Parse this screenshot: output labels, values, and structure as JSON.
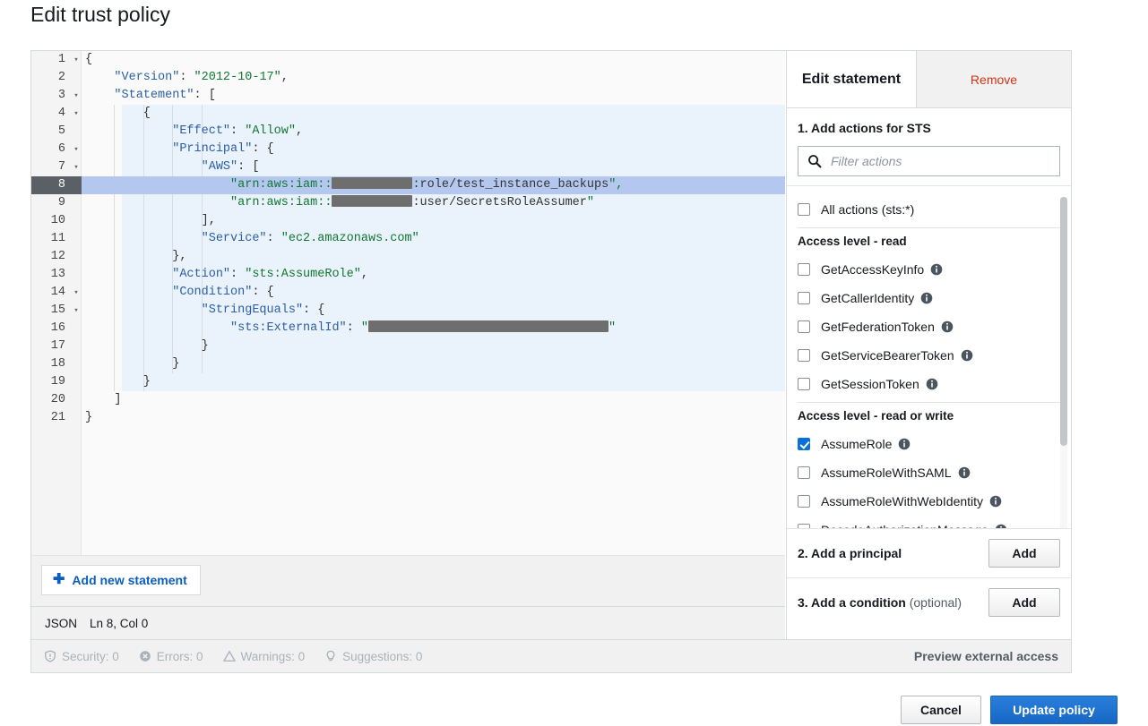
{
  "page_title": "Edit trust policy",
  "editor": {
    "language_label": "JSON",
    "cursor_label": "Ln 8, Col 0",
    "add_statement_label": "Add new statement",
    "add_statement_icon": "plus-icon",
    "active_line": 8,
    "lines": [
      {
        "n": "1",
        "fold": true,
        "text": "{"
      },
      {
        "n": "2",
        "fold": false,
        "text": "    \"Version\": \"2012-10-17\","
      },
      {
        "n": "3",
        "fold": true,
        "text": "    \"Statement\": ["
      },
      {
        "n": "4",
        "fold": true,
        "text": "        {"
      },
      {
        "n": "5",
        "fold": false,
        "text": "            \"Effect\": \"Allow\","
      },
      {
        "n": "6",
        "fold": true,
        "text": "            \"Principal\": {"
      },
      {
        "n": "7",
        "fold": true,
        "text": "                \"AWS\": ["
      },
      {
        "n": "8",
        "fold": false,
        "text": "                    \"arn:aws:iam::[REDACTED]:role/test_instance_backups\","
      },
      {
        "n": "9",
        "fold": false,
        "text": "                    \"arn:aws:iam::[REDACTED]:user/SecretsRoleAssumer\""
      },
      {
        "n": "10",
        "fold": false,
        "text": "                ],"
      },
      {
        "n": "11",
        "fold": false,
        "text": "                \"Service\": \"ec2.amazonaws.com\""
      },
      {
        "n": "12",
        "fold": false,
        "text": "            },"
      },
      {
        "n": "13",
        "fold": false,
        "text": "            \"Action\": \"sts:AssumeRole\","
      },
      {
        "n": "14",
        "fold": true,
        "text": "            \"Condition\": {"
      },
      {
        "n": "15",
        "fold": true,
        "text": "                \"StringEquals\": {"
      },
      {
        "n": "16",
        "fold": false,
        "text": "                    \"sts:ExternalId\": \"[REDACTED]\""
      },
      {
        "n": "17",
        "fold": false,
        "text": "                }"
      },
      {
        "n": "18",
        "fold": false,
        "text": "            }"
      },
      {
        "n": "19",
        "fold": false,
        "text": "        }"
      },
      {
        "n": "20",
        "fold": false,
        "text": "    ]"
      },
      {
        "n": "21",
        "fold": false,
        "text": "}"
      }
    ]
  },
  "side_panel": {
    "tab_label": "Edit statement",
    "remove_label": "Remove",
    "step1_title": "1. Add actions for STS",
    "filter_placeholder": "Filter actions",
    "filter_value": "",
    "search_icon": "search-icon",
    "all_actions_label": "All actions (sts:*)",
    "all_actions_checked": false,
    "groups": [
      {
        "header": "Access level - read",
        "items": [
          {
            "label": "GetAccessKeyInfo",
            "checked": false,
            "info": true
          },
          {
            "label": "GetCallerIdentity",
            "checked": false,
            "info": true
          },
          {
            "label": "GetFederationToken",
            "checked": false,
            "info": true
          },
          {
            "label": "GetServiceBearerToken",
            "checked": false,
            "info": true
          },
          {
            "label": "GetSessionToken",
            "checked": false,
            "info": true
          }
        ]
      },
      {
        "header": "Access level - read or write",
        "items": [
          {
            "label": "AssumeRole",
            "checked": true,
            "info": true
          },
          {
            "label": "AssumeRoleWithSAML",
            "checked": false,
            "info": true
          },
          {
            "label": "AssumeRoleWithWebIdentity",
            "checked": false,
            "info": true
          },
          {
            "label": "DecodeAuthorizationMessage",
            "checked": false,
            "info": true
          }
        ]
      }
    ],
    "step2_title": "2. Add a principal",
    "step2_button": "Add",
    "step3_title": "3. Add a condition",
    "step3_optional": "(optional)",
    "step3_button": "Add"
  },
  "analyzer": {
    "security": "Security: 0",
    "errors": "Errors: 0",
    "warnings": "Warnings: 0",
    "suggestions": "Suggestions: 0",
    "preview_label": "Preview external access"
  },
  "footer": {
    "cancel_label": "Cancel",
    "update_label": "Update policy"
  },
  "colors": {
    "accent_blue": "#0a6fd6",
    "remove_red": "#d13212",
    "json_key": "#2b5fa5",
    "json_string": "#117733",
    "active_line": "#b4c8ef",
    "block_highlight": "#eaf2fb",
    "redaction": "#6e6e6e"
  }
}
